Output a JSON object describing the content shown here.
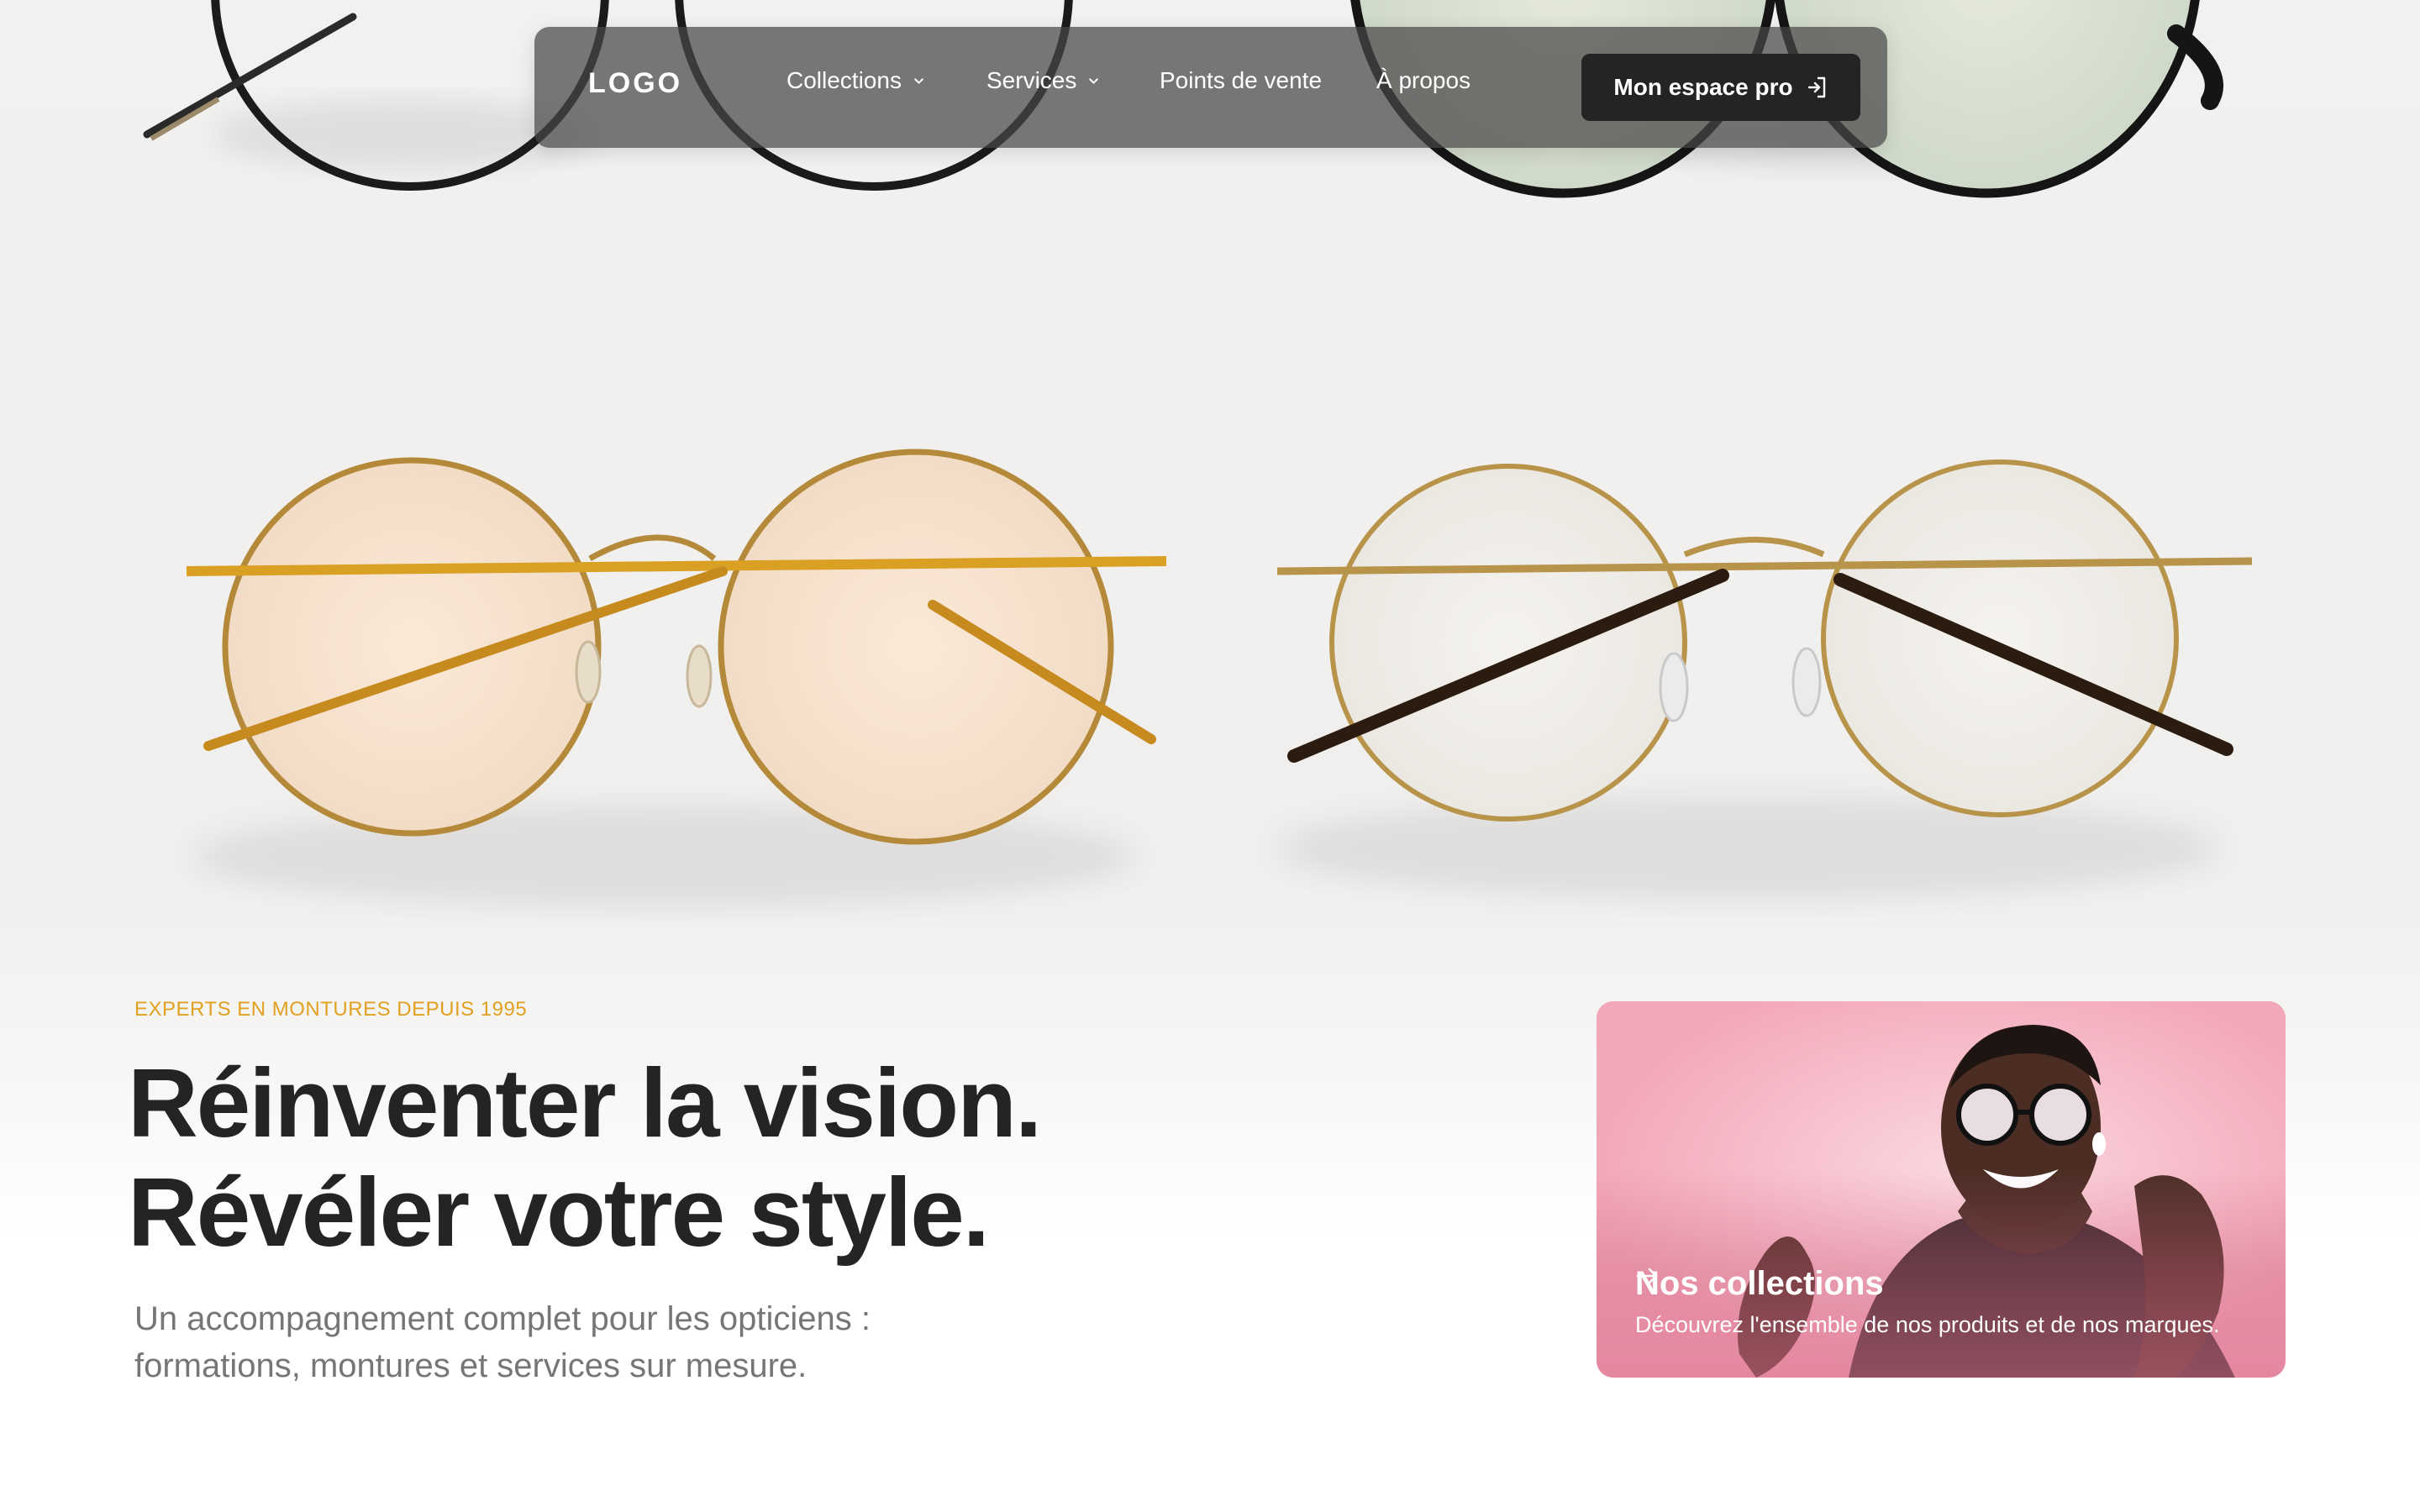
{
  "nav": {
    "logo": "LOGO",
    "items": [
      {
        "label": "Collections",
        "has_dropdown": true
      },
      {
        "label": "Services",
        "has_dropdown": true
      },
      {
        "label": "Points de vente",
        "has_dropdown": false
      },
      {
        "label": "À propos",
        "has_dropdown": false
      }
    ],
    "cta_label": "Mon espace pro",
    "cta_icon": "login-icon"
  },
  "hero": {
    "eyebrow": "EXPERTS EN MONTURES DEPUIS 1995",
    "headline_line1": "Réinventer la vision.",
    "headline_line2": "Révéler votre style.",
    "subtitle_line1": "Un accompagnement complet pour les opticiens :",
    "subtitle_line2": "formations, montures et services sur mesure."
  },
  "card": {
    "title": "Nos collections",
    "title_icon": "arrow-right-icon",
    "description": "Découvrez l'ensemble de nos produits et de nos marques."
  },
  "colors": {
    "accent": "#e2a020",
    "heading": "#242424",
    "body_text": "#767676",
    "nav_bg": "#464646",
    "button_bg": "#242424",
    "card_bg": "#f4aebe"
  }
}
